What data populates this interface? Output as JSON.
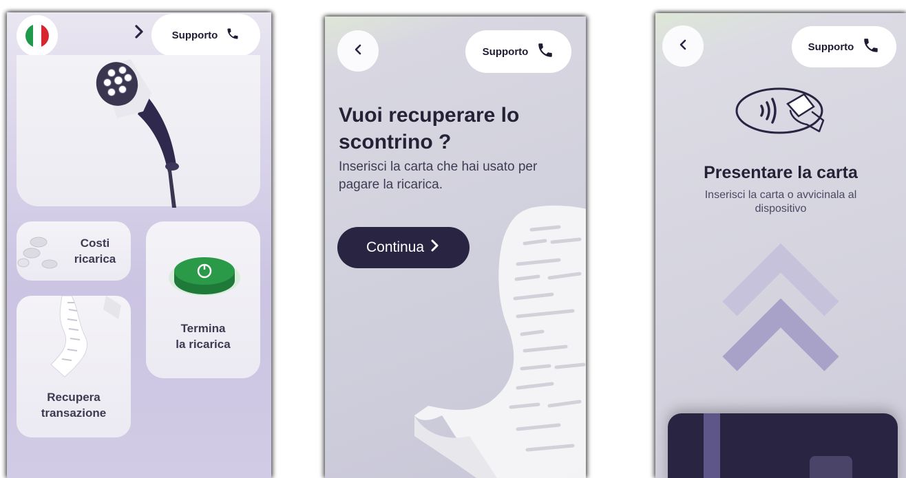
{
  "screen_home": {
    "support_label": "Supporto",
    "card_costs": "Costi\nricarica",
    "card_stop": "Termina\nla ricarica",
    "card_recover": "Recupera\ntransazione",
    "icons": [
      "italy-flag-icon",
      "chevron-right-icon",
      "phone-icon",
      "ev-connector-icon",
      "coins-icon",
      "stop-button-icon",
      "receipt-icon"
    ]
  },
  "screen_receipt": {
    "support_label": "Supporto",
    "title": "Vuoi recuperare lo scontrino ?",
    "subtitle": "Inserisci la carta che hai usato per pagare la ricarica.",
    "continue_label": "Continua",
    "icons": [
      "chevron-left-icon",
      "phone-icon",
      "chevron-right-icon",
      "receipt-icon"
    ]
  },
  "screen_card": {
    "support_label": "Supporto",
    "title": "Presentare la carta",
    "subtitle": "Inserisci la carta o avvicinala al dispositivo",
    "icons": [
      "chevron-left-icon",
      "phone-icon",
      "contactless-card-icon",
      "double-chevron-up-icon",
      "payment-card-icon"
    ]
  },
  "colors": {
    "dark_navy": "#2a2443",
    "green_button": "#2b9a48",
    "lavender_bg": "#cfc9e3"
  }
}
